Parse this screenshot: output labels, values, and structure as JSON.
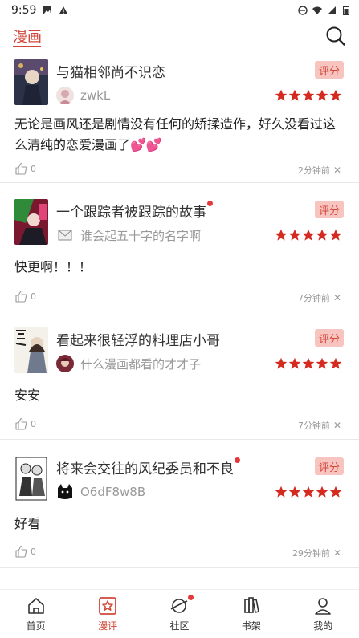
{
  "status_bar": {
    "time": "9:59"
  },
  "app": {
    "title": "漫画"
  },
  "reviews": [
    {
      "title": "与猫相邻尚不识恋",
      "has_dot": false,
      "rate_label": "评分",
      "username": "zwkL",
      "stars": 5,
      "content": "无论是画风还是剧情没有任何的矫揉造作，好久没看过这么清纯的恋爱漫画了💕💕",
      "likes": "0",
      "time": "2分钟前"
    },
    {
      "title": "一个跟踪者被跟踪的故事",
      "has_dot": true,
      "rate_label": "评分",
      "username": "谁会起五十字的名字啊",
      "stars": 5,
      "content": "快更啊！！！",
      "likes": "0",
      "time": "7分钟前"
    },
    {
      "title": "看起来很轻浮的料理店小哥",
      "has_dot": false,
      "rate_label": "评分",
      "username": "什么漫画都看的才才子",
      "stars": 5,
      "content": "安安",
      "likes": "0",
      "time": "7分钟前"
    },
    {
      "title": "将来会交往的风纪委员和不良",
      "has_dot": true,
      "rate_label": "评分",
      "username": "O6dF8w8B",
      "stars": 5,
      "content": "好看",
      "likes": "0",
      "time": "29分钟前"
    }
  ],
  "tabs": [
    {
      "label": "首页",
      "icon": "home-icon",
      "active": false
    },
    {
      "label": "漫评",
      "icon": "star-review-icon",
      "active": true
    },
    {
      "label": "社区",
      "icon": "planet-icon",
      "active": false,
      "dot": true
    },
    {
      "label": "书架",
      "icon": "bookshelf-icon",
      "active": false
    },
    {
      "label": "我的",
      "icon": "profile-icon",
      "active": false
    }
  ],
  "colors": {
    "accent": "#d2473a",
    "star": "#d42a1f",
    "rate_bg": "#f7c4c0"
  }
}
